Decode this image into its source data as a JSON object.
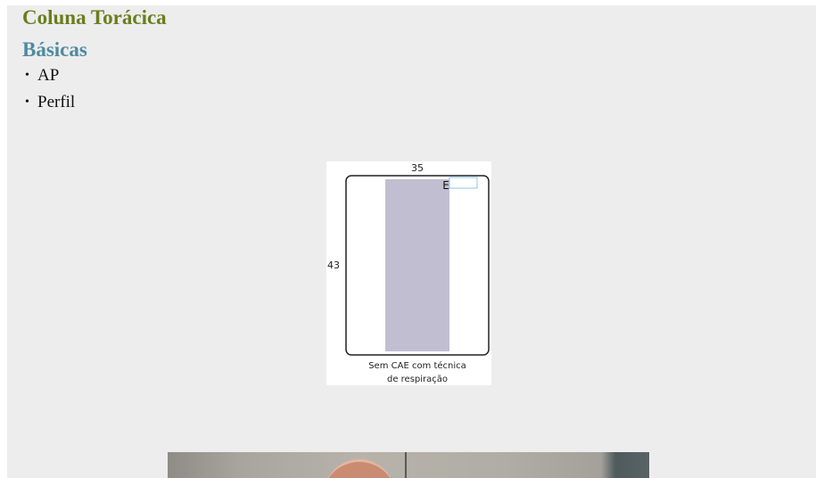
{
  "header": {
    "title": "Coluna Torácica",
    "subtitle": "Básicas"
  },
  "projections": [
    {
      "label": "AP"
    },
    {
      "label": "Perfil"
    }
  ],
  "cassette_diagram": {
    "width_label": "35",
    "height_label": "43",
    "marker_label": "E",
    "caption_line1": "Sem CAE com técnica",
    "caption_line2": "de respiração"
  },
  "colors": {
    "title": "#6b7d1c",
    "subtitle": "#4f8aa0",
    "exposure_field": "#c1bed1",
    "marker_box": "#8cc7e6"
  }
}
